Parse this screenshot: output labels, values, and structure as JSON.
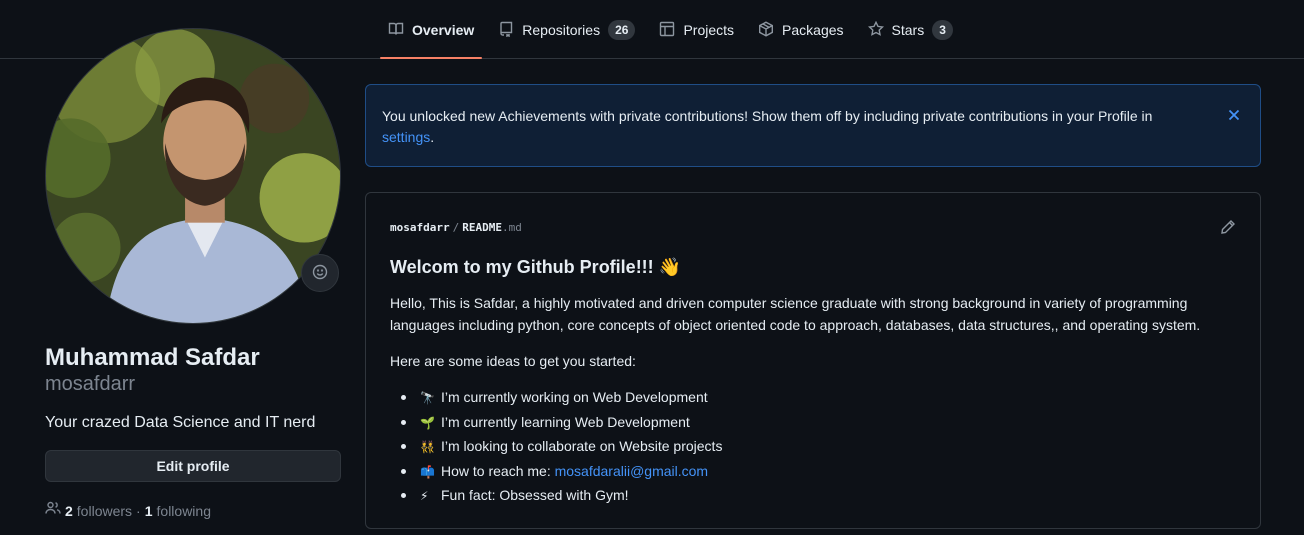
{
  "tabs": [
    {
      "label": "Overview",
      "icon": "book-icon",
      "active": true
    },
    {
      "label": "Repositories",
      "icon": "repo-icon",
      "count": "26"
    },
    {
      "label": "Projects",
      "icon": "table-icon"
    },
    {
      "label": "Packages",
      "icon": "package-icon"
    },
    {
      "label": "Stars",
      "icon": "star-icon",
      "count": "3"
    }
  ],
  "profile": {
    "full_name": "Muhammad Safdar",
    "username": "mosafdarr",
    "bio": "Your crazed Data Science and IT nerd",
    "edit_label": "Edit profile",
    "followers_count": "2",
    "followers_label": "followers",
    "dot": "·",
    "following_count": "1",
    "following_label": "following"
  },
  "banner": {
    "text": "You unlocked new Achievements with private contributions! Show them off by including private contributions in your Profile in",
    "link": "settings",
    "period": "."
  },
  "readme": {
    "owner": "mosafdarr",
    "separator": "/",
    "file": "README",
    "ext": ".md",
    "heading": "Welcom to my Github Profile!!! 👋",
    "intro": "Hello, This is Safdar, a highly motivated and driven computer science graduate with strong background in variety of programming languages including python, core concepts of object oriented code to approach, databases, data structures,, and operating system.",
    "ideas": "Here are some ideas to get you started:",
    "items": [
      {
        "emoji": "🔭",
        "text": "I’m currently working on Web Development"
      },
      {
        "emoji": "🌱",
        "text": "I’m currently learning Web Development"
      },
      {
        "emoji": "👯",
        "text": "I’m looking to collaborate on Website projects"
      },
      {
        "emoji": "📫",
        "text": "How to reach me: ",
        "link": "mosafdaralii@gmail.com"
      },
      {
        "emoji": "⚡",
        "text": "Fun fact: Obsessed with Gym!"
      }
    ]
  },
  "colors": {
    "background": "#0d1117",
    "accent_tab": "#f78166",
    "link": "#4493f8",
    "border": "#30363d"
  }
}
